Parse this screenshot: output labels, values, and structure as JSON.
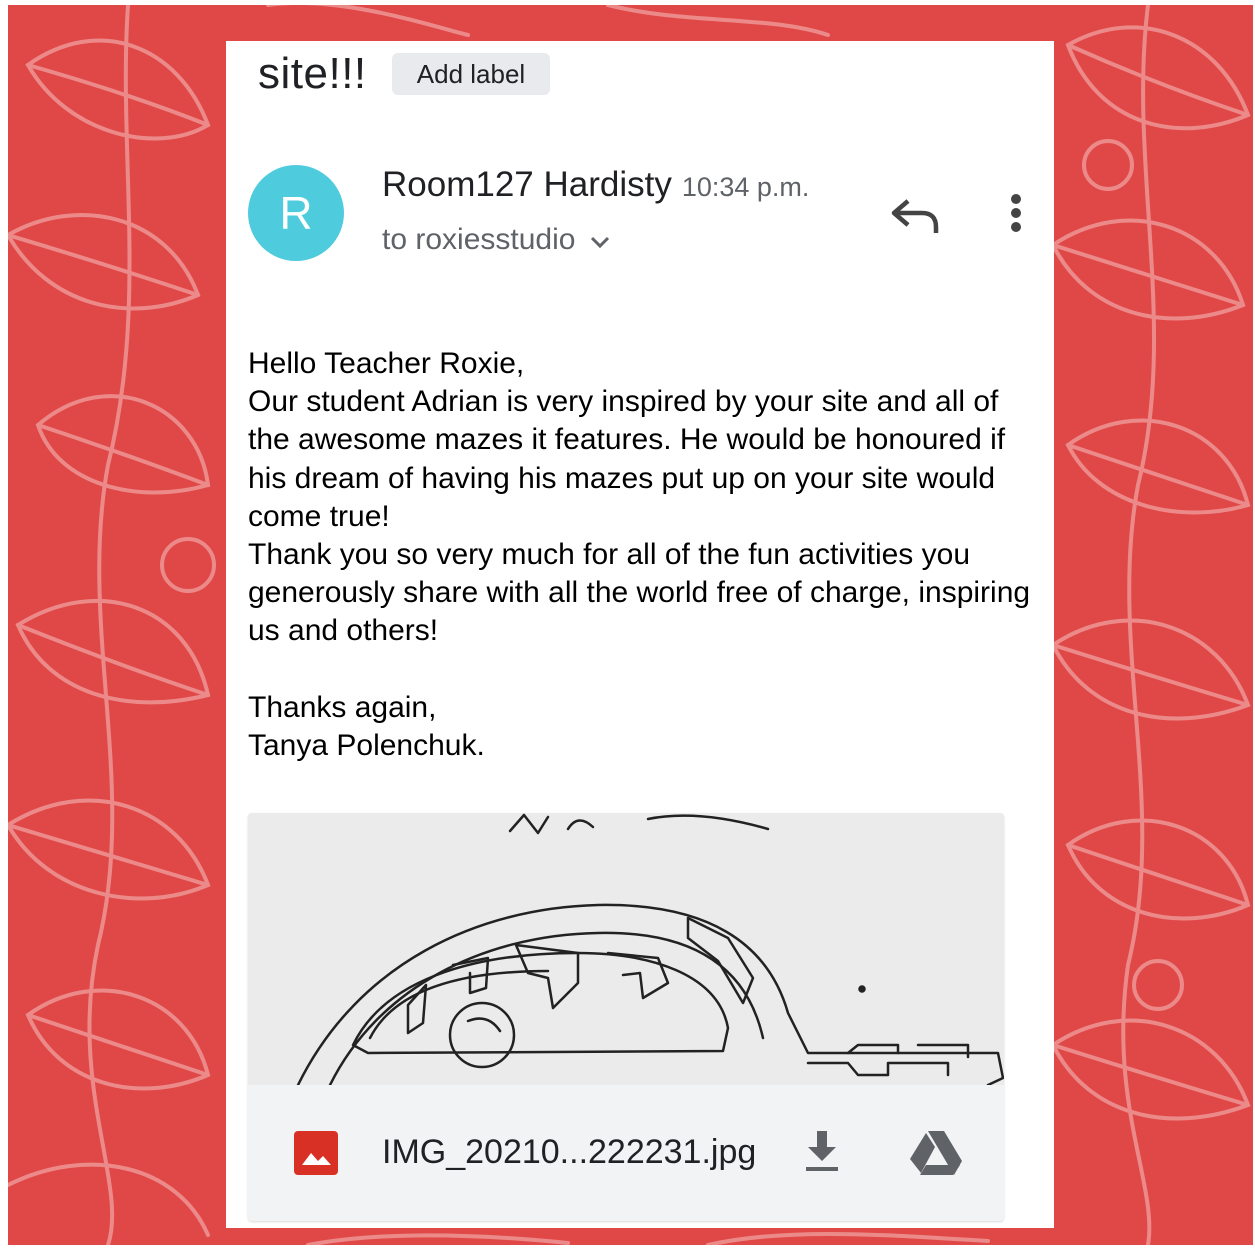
{
  "email": {
    "subject_fragment": "site!!!",
    "add_label": "Add label",
    "sender": {
      "avatar_letter": "R",
      "avatar_color": "#4ecbdc",
      "name": "Room127 Hardisty",
      "time": "10:34 p.m.",
      "recipient": "to roxiesstudio"
    },
    "body": {
      "greeting": "Hello Teacher Roxie,",
      "paragraph1": "Our student Adrian is very inspired by your site and all of the awesome mazes it features. He would be honoured if his dream of having his mazes put up on your site would come true!",
      "paragraph2": "Thank you so very much for all of the fun activities you generously share with all the world free of charge, inspiring us and others!",
      "closing": "Thanks again,",
      "signature": "Tanya Polenchuk."
    },
    "attachment": {
      "filename": "IMG_20210...222231.jpg",
      "icon": "image-file-icon",
      "icon_color": "#d93025"
    }
  },
  "icons": {
    "reply": "reply-icon",
    "more": "more-vert-icon",
    "expand": "chevron-down-icon",
    "download": "download-icon",
    "drive": "google-drive-icon"
  },
  "colors": {
    "background": "#e04848",
    "card": "#ffffff",
    "attachment_bar": "#f1f3f4"
  }
}
